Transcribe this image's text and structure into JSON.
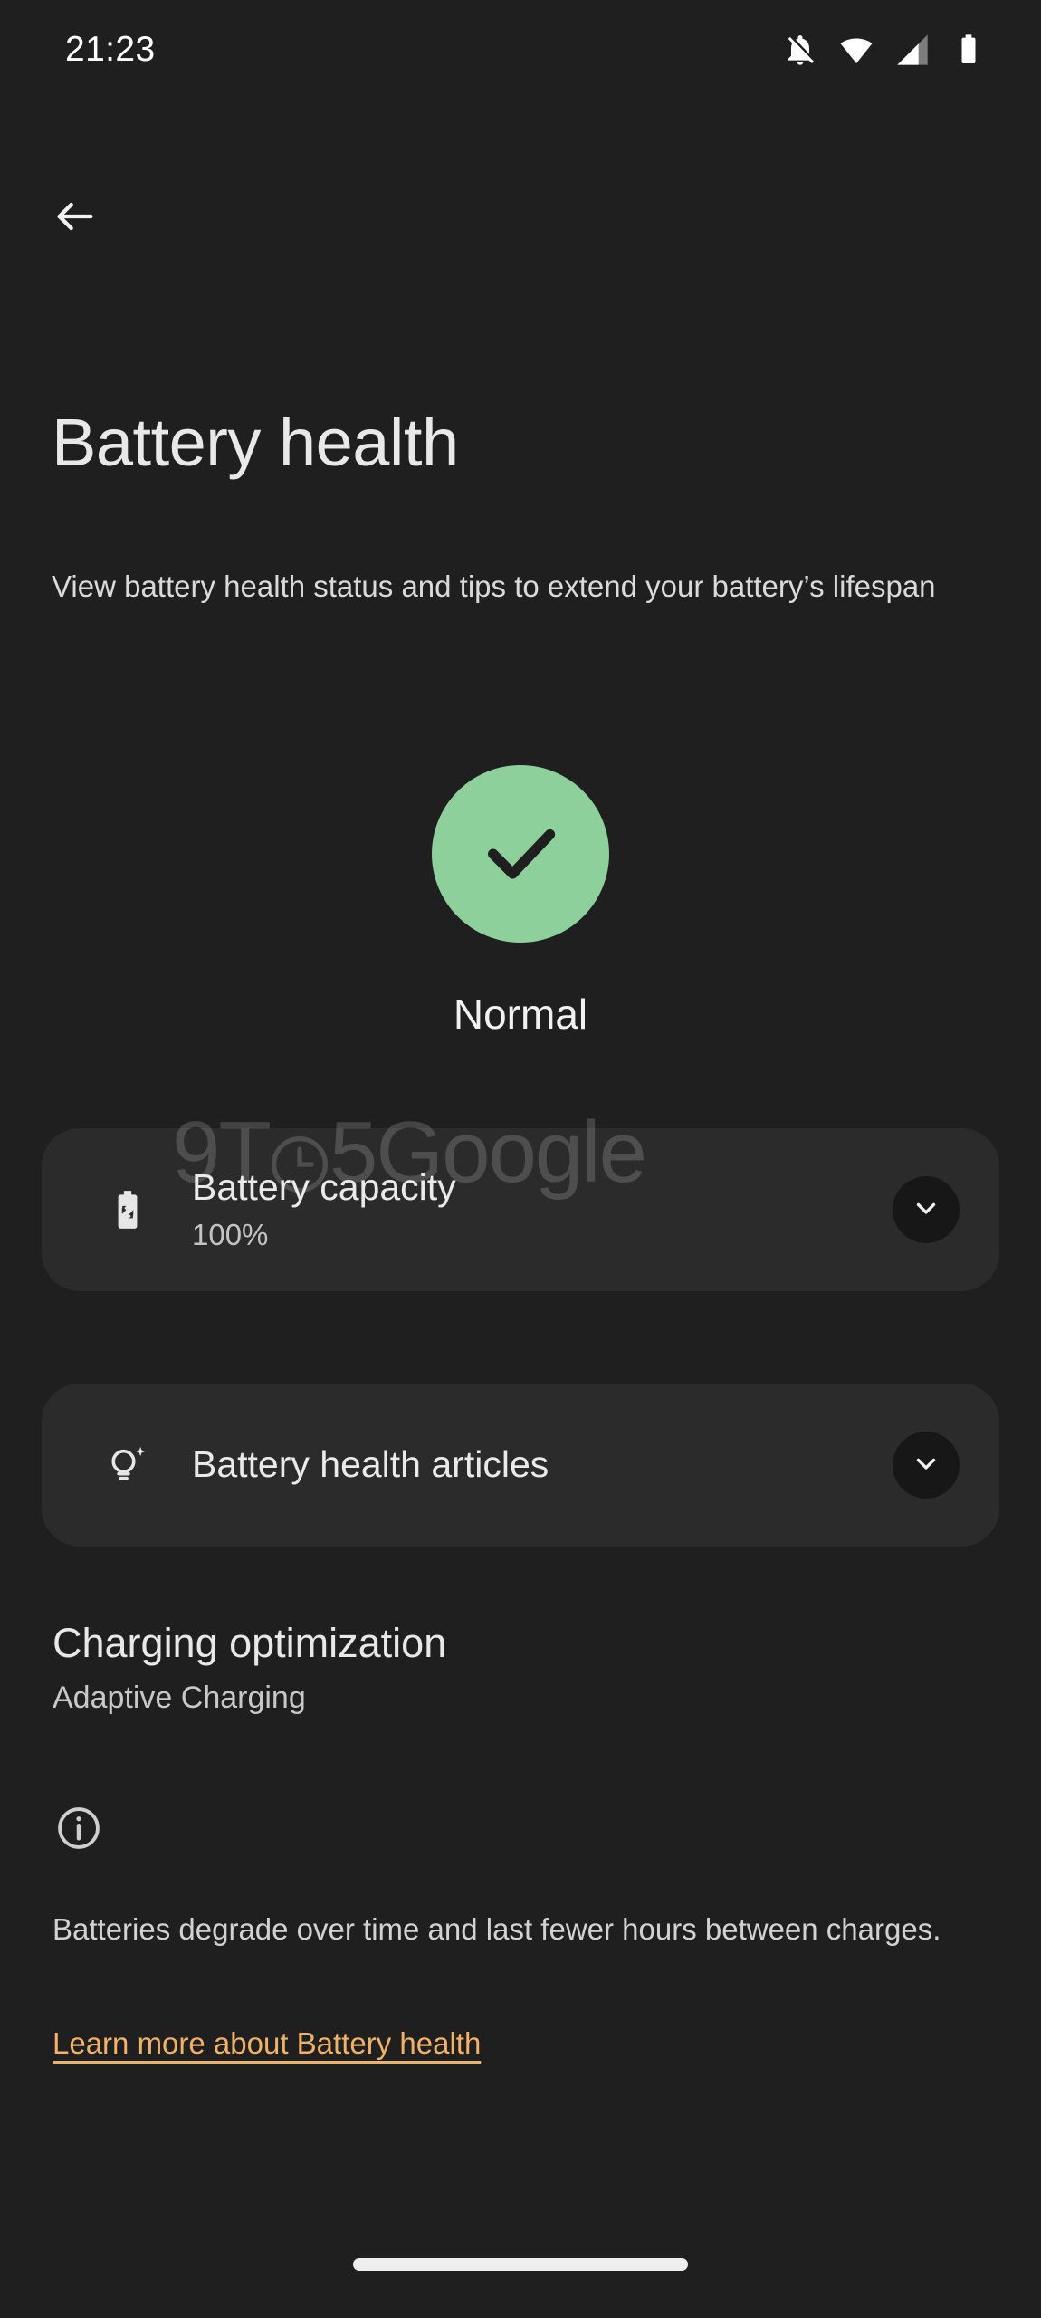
{
  "status_bar": {
    "time": "21:23",
    "icons": [
      {
        "name": "notifications-off-icon",
        "label": "Notifications silenced"
      },
      {
        "name": "wifi-icon",
        "label": "Wi-Fi full signal"
      },
      {
        "name": "cellular-signal-icon",
        "label": "Mobile signal"
      },
      {
        "name": "battery-icon",
        "label": "Battery"
      }
    ]
  },
  "nav": {
    "back_label": "Back"
  },
  "header": {
    "title": "Battery health",
    "subtitle": "View battery health status and tips to extend your battery’s lifespan"
  },
  "status_hero": {
    "label": "Normal",
    "icon": "check-icon",
    "circle_color": "#8ed09b",
    "check_color": "#1f1f1f"
  },
  "watermark": {
    "prefix": "9T",
    "suffix": "5Google"
  },
  "cards": [
    {
      "id": "battery-capacity",
      "icon": "battery-exchange-icon",
      "title": "Battery capacity",
      "subtitle": "100%",
      "expand_icon": "chevron-down-icon"
    },
    {
      "id": "battery-health-articles",
      "icon": "lightbulb-sparkle-icon",
      "title": "Battery health articles",
      "subtitle": "",
      "expand_icon": "chevron-down-icon"
    }
  ],
  "charging_optimization": {
    "title": "Charging optimization",
    "subtitle": "Adaptive Charging"
  },
  "footer": {
    "info_icon": "info-icon",
    "text": "Batteries degrade over time and last fewer hours between charges.",
    "link": "Learn more about Battery health",
    "link_color": "#f0b168"
  },
  "system_nav": {
    "home_handle": "Home gesture bar"
  }
}
